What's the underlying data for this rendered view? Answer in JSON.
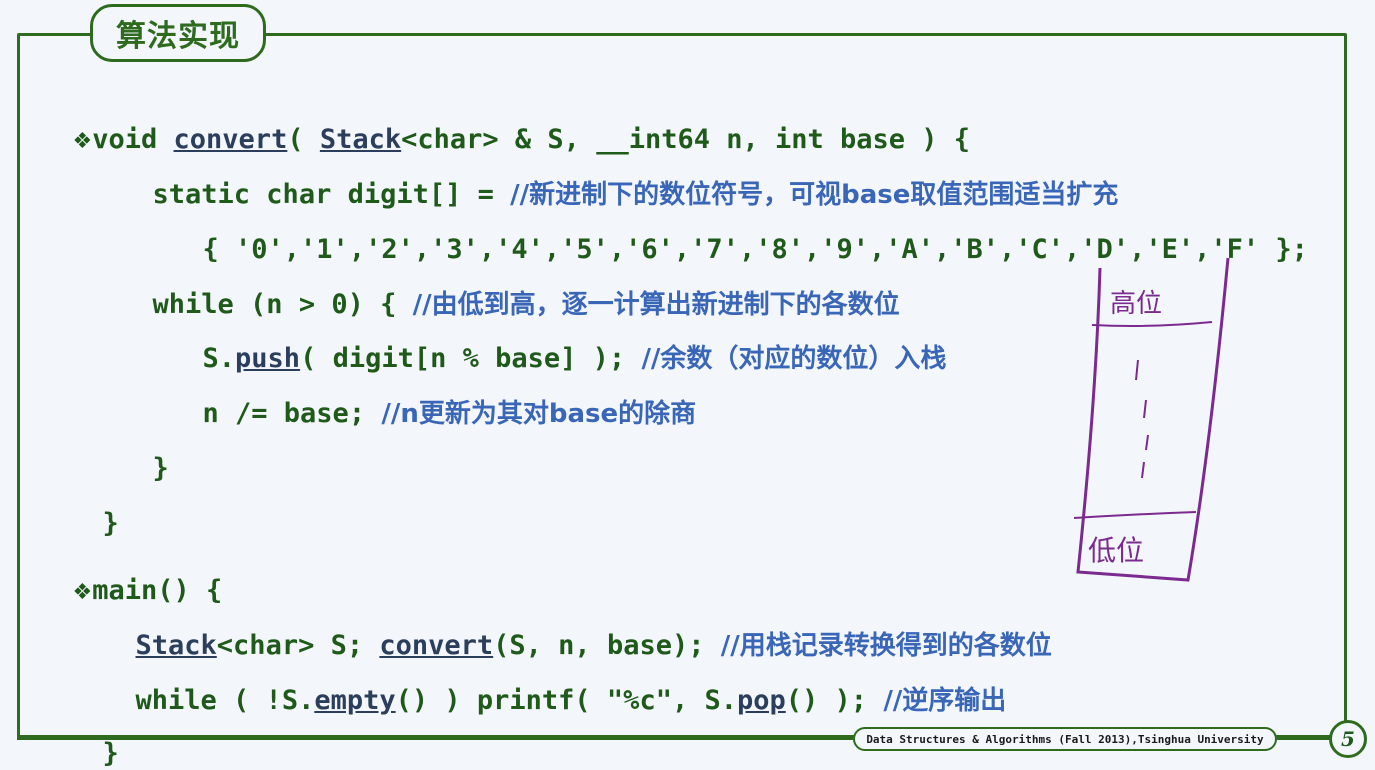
{
  "title": "算法实现",
  "bullet": "❖",
  "code": {
    "l1": {
      "kw": "void ",
      "fn": "convert",
      "a": "( ",
      "type": "Stack",
      "b": "<char> & S, __int64 n, int base ) {"
    },
    "l2": {
      "code": "static char digit[] = ",
      "comment": "//新进制下的数位符号，可视base取值范围适当扩充"
    },
    "l3": {
      "code": "{ '0','1','2','3','4','5','6','7','8','9','A','B','C','D','E','F' };"
    },
    "l4": {
      "code": "while (n > 0) { ",
      "comment": "//由低到高，逐一计算出新进制下的各数位"
    },
    "l5": {
      "a": "S.",
      "fn": "push",
      "b": "( digit[n % base] ); ",
      "comment": "//余数（对应的数位）入栈"
    },
    "l6": {
      "code": "n /= base; ",
      "comment": "//n更新为其对base的除商"
    },
    "l7": {
      "code": "}"
    },
    "l8": {
      "code": "}"
    },
    "l9": {
      "code": "main() {"
    },
    "l10": {
      "type": "Stack",
      "a": "<char> S; ",
      "fn": "convert",
      "b": "(S, n, base); ",
      "comment": "//用栈记录转换得到的各数位"
    },
    "l11": {
      "a": "while ( !S.",
      "fn1": "empty",
      "b": "() ) printf( \"%c\", S.",
      "fn2": "pop",
      "c": "() ); ",
      "comment": "//逆序输出"
    },
    "l12": {
      "code": "}"
    }
  },
  "sketch": {
    "top_label": "高位",
    "bottom_label": "低位"
  },
  "footer": "Data Structures & Algorithms (Fall 2013),Tsinghua University",
  "page_number": "5"
}
